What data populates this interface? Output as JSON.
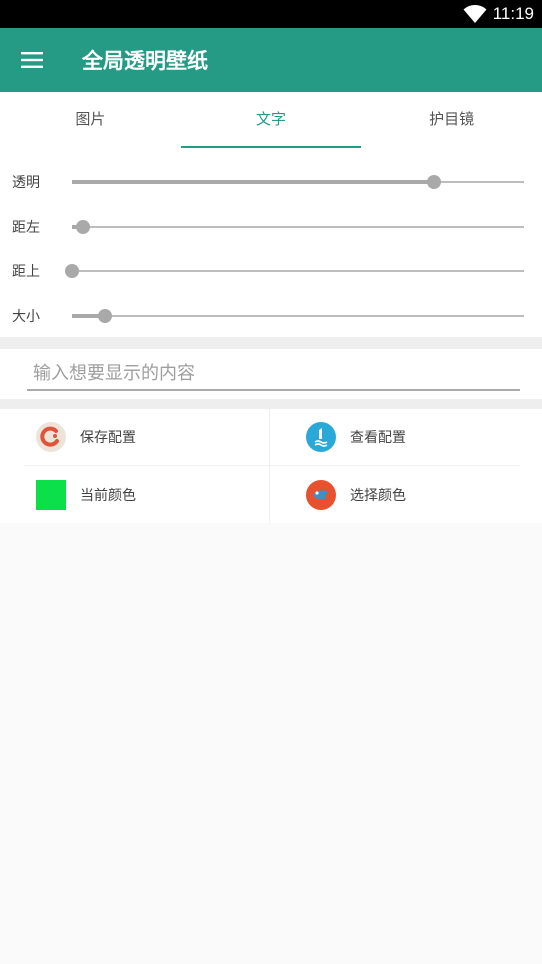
{
  "status_bar": {
    "time": "11:19",
    "wifi_icon": "wifi-icon"
  },
  "app_bar": {
    "menu_icon": "menu-icon",
    "title": "全局透明壁纸"
  },
  "tabs": [
    {
      "label": "图片",
      "active": false
    },
    {
      "label": "文字",
      "active": true
    },
    {
      "label": "护目镜",
      "active": false
    }
  ],
  "sliders": [
    {
      "label": "透明",
      "value": 0.8
    },
    {
      "label": "距左",
      "value": 0.025
    },
    {
      "label": "距上",
      "value": 0.0
    },
    {
      "label": "大小",
      "value": 0.073
    }
  ],
  "text_input": {
    "placeholder": "输入想要显示的内容",
    "value": ""
  },
  "actions": {
    "save_config": {
      "label": "保存配置",
      "icon": "save-config-icon"
    },
    "view_config": {
      "label": "查看配置",
      "icon": "view-config-icon"
    },
    "current_color": {
      "label": "当前颜色",
      "color": "#0be04a"
    },
    "choose_color": {
      "label": "选择颜色",
      "icon": "palette-icon"
    }
  },
  "colors": {
    "accent": "#259b86",
    "status_bar": "#000000",
    "slider": "#a9a9a9"
  }
}
